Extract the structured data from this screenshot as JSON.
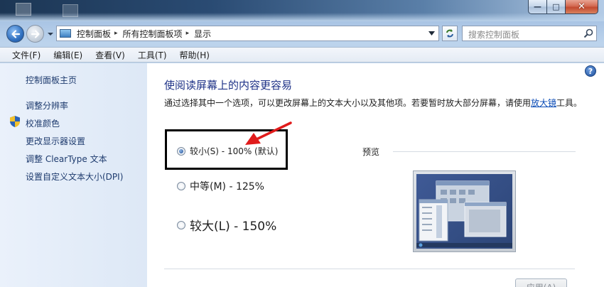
{
  "window": {
    "minimize_glyph": "—",
    "maximize_glyph": "□",
    "close_glyph": "✕"
  },
  "address": {
    "segments": [
      "控制面板",
      "所有控制面板项",
      "显示"
    ],
    "separator": "▸"
  },
  "search": {
    "placeholder": "搜索控制面板"
  },
  "menu": [
    "文件(F)",
    "编辑(E)",
    "查看(V)",
    "工具(T)",
    "帮助(H)"
  ],
  "sidebar": {
    "items": [
      {
        "label": "控制面板主页"
      },
      {
        "label": "调整分辨率"
      },
      {
        "label": "校准颜色"
      },
      {
        "label": "更改显示器设置"
      },
      {
        "label": "调整 ClearType 文本"
      },
      {
        "label": "设置自定义文本大小(DPI)"
      }
    ]
  },
  "main": {
    "title": "使阅读屏幕上的内容更容易",
    "description_before_link": "通过选择其中一个选项，可以更改屏幕上的文本大小以及其他项。若要暂时放大部分屏幕，请使用",
    "description_link": "放大镜",
    "description_after_link": "工具。",
    "options": [
      {
        "label": "较小(S) - 100% (默认)",
        "selected": true
      },
      {
        "label": "中等(M) - 125%",
        "selected": false
      },
      {
        "label": "较大(L) - 150%",
        "selected": false
      }
    ],
    "preview_label": "预览",
    "apply_label": "应用(A)"
  },
  "help_glyph": "?",
  "colors": {
    "link": "#1e3b6e",
    "title": "#1e3287",
    "annotation_arrow": "#e01b1b",
    "annotation_box": "#000000"
  }
}
